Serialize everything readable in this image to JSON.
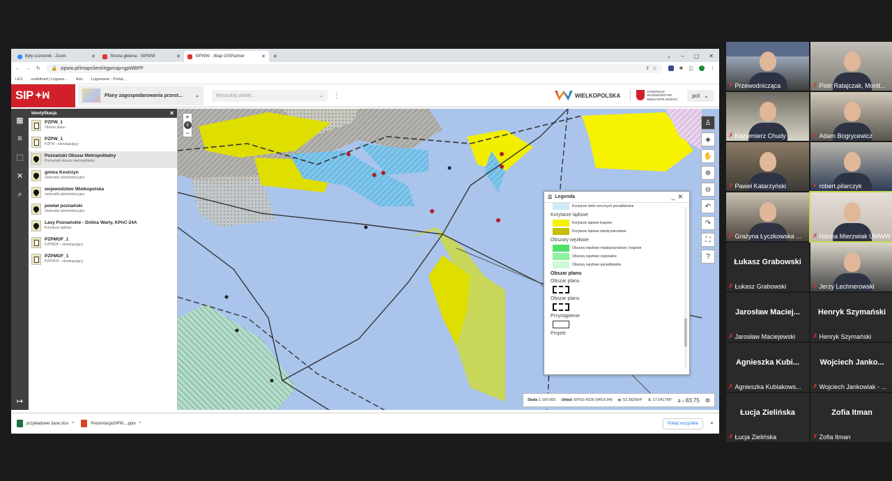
{
  "browser": {
    "tabs": [
      {
        "label": "Były uczestnik - Zoom",
        "active": false
      },
      {
        "label": "Strona główna - SIPWW",
        "active": false
      },
      {
        "label": "SIPWW - iMap GISPartner",
        "active": true
      }
    ],
    "url": "sipww.pl/imapclient/#gpmap=gpWBPP",
    "bookmarks": [
      "LEX",
      "undefined | Logowa...",
      "Adu",
      "Logowanie - Portal..."
    ],
    "profile_initial": "B"
  },
  "app": {
    "logo": "SIP",
    "layer_selector": "Plany zagospodarowania przest...",
    "search_placeholder": "Wyszukaj obiekt...",
    "brand_wielkopolska": "WIELKOPOLSKA",
    "samorzad": [
      "SAMORZĄD",
      "WOJEWÓDZTWA",
      "WIELKOPOLSKIEGO"
    ],
    "language": "pol"
  },
  "identify_panel": {
    "title": "Identyfikacja",
    "items": [
      {
        "title": "PZPW_1",
        "subtitle": "Obszar planu",
        "icon": "document",
        "selected": false
      },
      {
        "title": "PZPW_1",
        "subtitle": "PZPW - obowiązujący",
        "icon": "document",
        "selected": false
      },
      {
        "title": "Poznański Obszar Metropolitalny",
        "subtitle": "Poznański obszar metropolitalny",
        "icon": "pin",
        "selected": true
      },
      {
        "title": "gmina Kostrzyn",
        "subtitle": "Jednostki administracyjne",
        "icon": "pin",
        "selected": false
      },
      {
        "title": "województwo Wielkopolska",
        "subtitle": "Jednostki administracyjne",
        "icon": "pin",
        "selected": false
      },
      {
        "title": "powiat poznański",
        "subtitle": "Jednostki administracyjne",
        "icon": "pin",
        "selected": false
      },
      {
        "title": "Lasy Poznańskie - Dolina Warty, KPnC-24A",
        "subtitle": "Korytarze lądowe",
        "icon": "pin",
        "selected": false
      },
      {
        "title": "PZPMOF_1",
        "subtitle": "PZPMOF - obowiązujący",
        "icon": "document",
        "selected": false
      },
      {
        "title": "PZPMOF_1",
        "subtitle": "PZPMOF - obowiązujący",
        "icon": "document",
        "selected": false
      }
    ]
  },
  "map": {
    "zoom_level": "9"
  },
  "legend": {
    "title": "Legenda",
    "cut_row": "Korytarze doliń rzecznych ponadlokalne",
    "sections": [
      {
        "name": "Korytarze lądowe",
        "bold": false,
        "rows": [
          {
            "label": "Korytarze lądowe krajowe",
            "color": "#f6f200"
          },
          {
            "label": "Korytarze lądowe międzynarodowe",
            "color": "#c8be00"
          }
        ]
      },
      {
        "name": "Obszary węzłowe",
        "bold": false,
        "rows": [
          {
            "label": "Obszary węzłowe międzynarodowe i krajowe",
            "color": "#4fe06a"
          },
          {
            "label": "Obszary węzłowe regionalne",
            "color": "#8ff2a0"
          },
          {
            "label": "Obszary węzłowe ponadlokalne",
            "color": "#ccf8d4"
          }
        ]
      }
    ],
    "plan_header": "Obszar planu",
    "plan_rows": [
      "Obszar planu",
      "Obszar planu",
      "Przystąpienie",
      "Projekt"
    ]
  },
  "status": {
    "scale_label": "Skala",
    "scale": "1:150 000",
    "crs_label": "Układ:",
    "crs": "EPSG 4326 (WGS 84)",
    "phi_label": "φ:",
    "phi": "52.362654°",
    "lambda_label": "λ:",
    "lambda": "17.041796°",
    "z_label": "Z:",
    "zoom_value": "83.75"
  },
  "downloads": {
    "files": [
      "przykładowe dane.xlsx",
      "PrezentacjaSIPW....pptx"
    ],
    "show_all": "Pokaż wszystkie"
  },
  "participants": [
    {
      "name": "Przewodnicząca",
      "video": true
    },
    {
      "name": "Piotr Ratajczak, Monit...",
      "video": true
    },
    {
      "name": "Kaziemierz Chudy",
      "video": true
    },
    {
      "name": "Adam Bogrycewicz",
      "video": true
    },
    {
      "name": "Paweł Katarzyński",
      "video": true
    },
    {
      "name": "robert.pilarczyk",
      "video": true
    },
    {
      "name": "Grażyna Łyczkowska ...",
      "video": true
    },
    {
      "name": "Hanna Mierzwiak UMWW",
      "video": true,
      "highlight": true
    },
    {
      "name": "Łukasz Grabowski",
      "big": "Łukasz Grabowski",
      "video": false
    },
    {
      "name": "Jerzy Lechnerowski",
      "video": true
    },
    {
      "name": "Jarosław Maciejewski",
      "big": "Jarosław Maciej...",
      "video": false
    },
    {
      "name": "Henryk Szymański",
      "big": "Henryk Szymański",
      "video": false
    },
    {
      "name": "Agnieszka Kubiakows...",
      "big": "Agnieszka Kubi...",
      "video": false
    },
    {
      "name": "Wojciech Jankowiak - ...",
      "big": "Wojciech Janko...",
      "video": false
    },
    {
      "name": "Łucja Zielińska",
      "big": "Łucja Zielińska",
      "video": false
    },
    {
      "name": "Zofia Itman",
      "big": "Zofia Itman",
      "video": false
    }
  ]
}
